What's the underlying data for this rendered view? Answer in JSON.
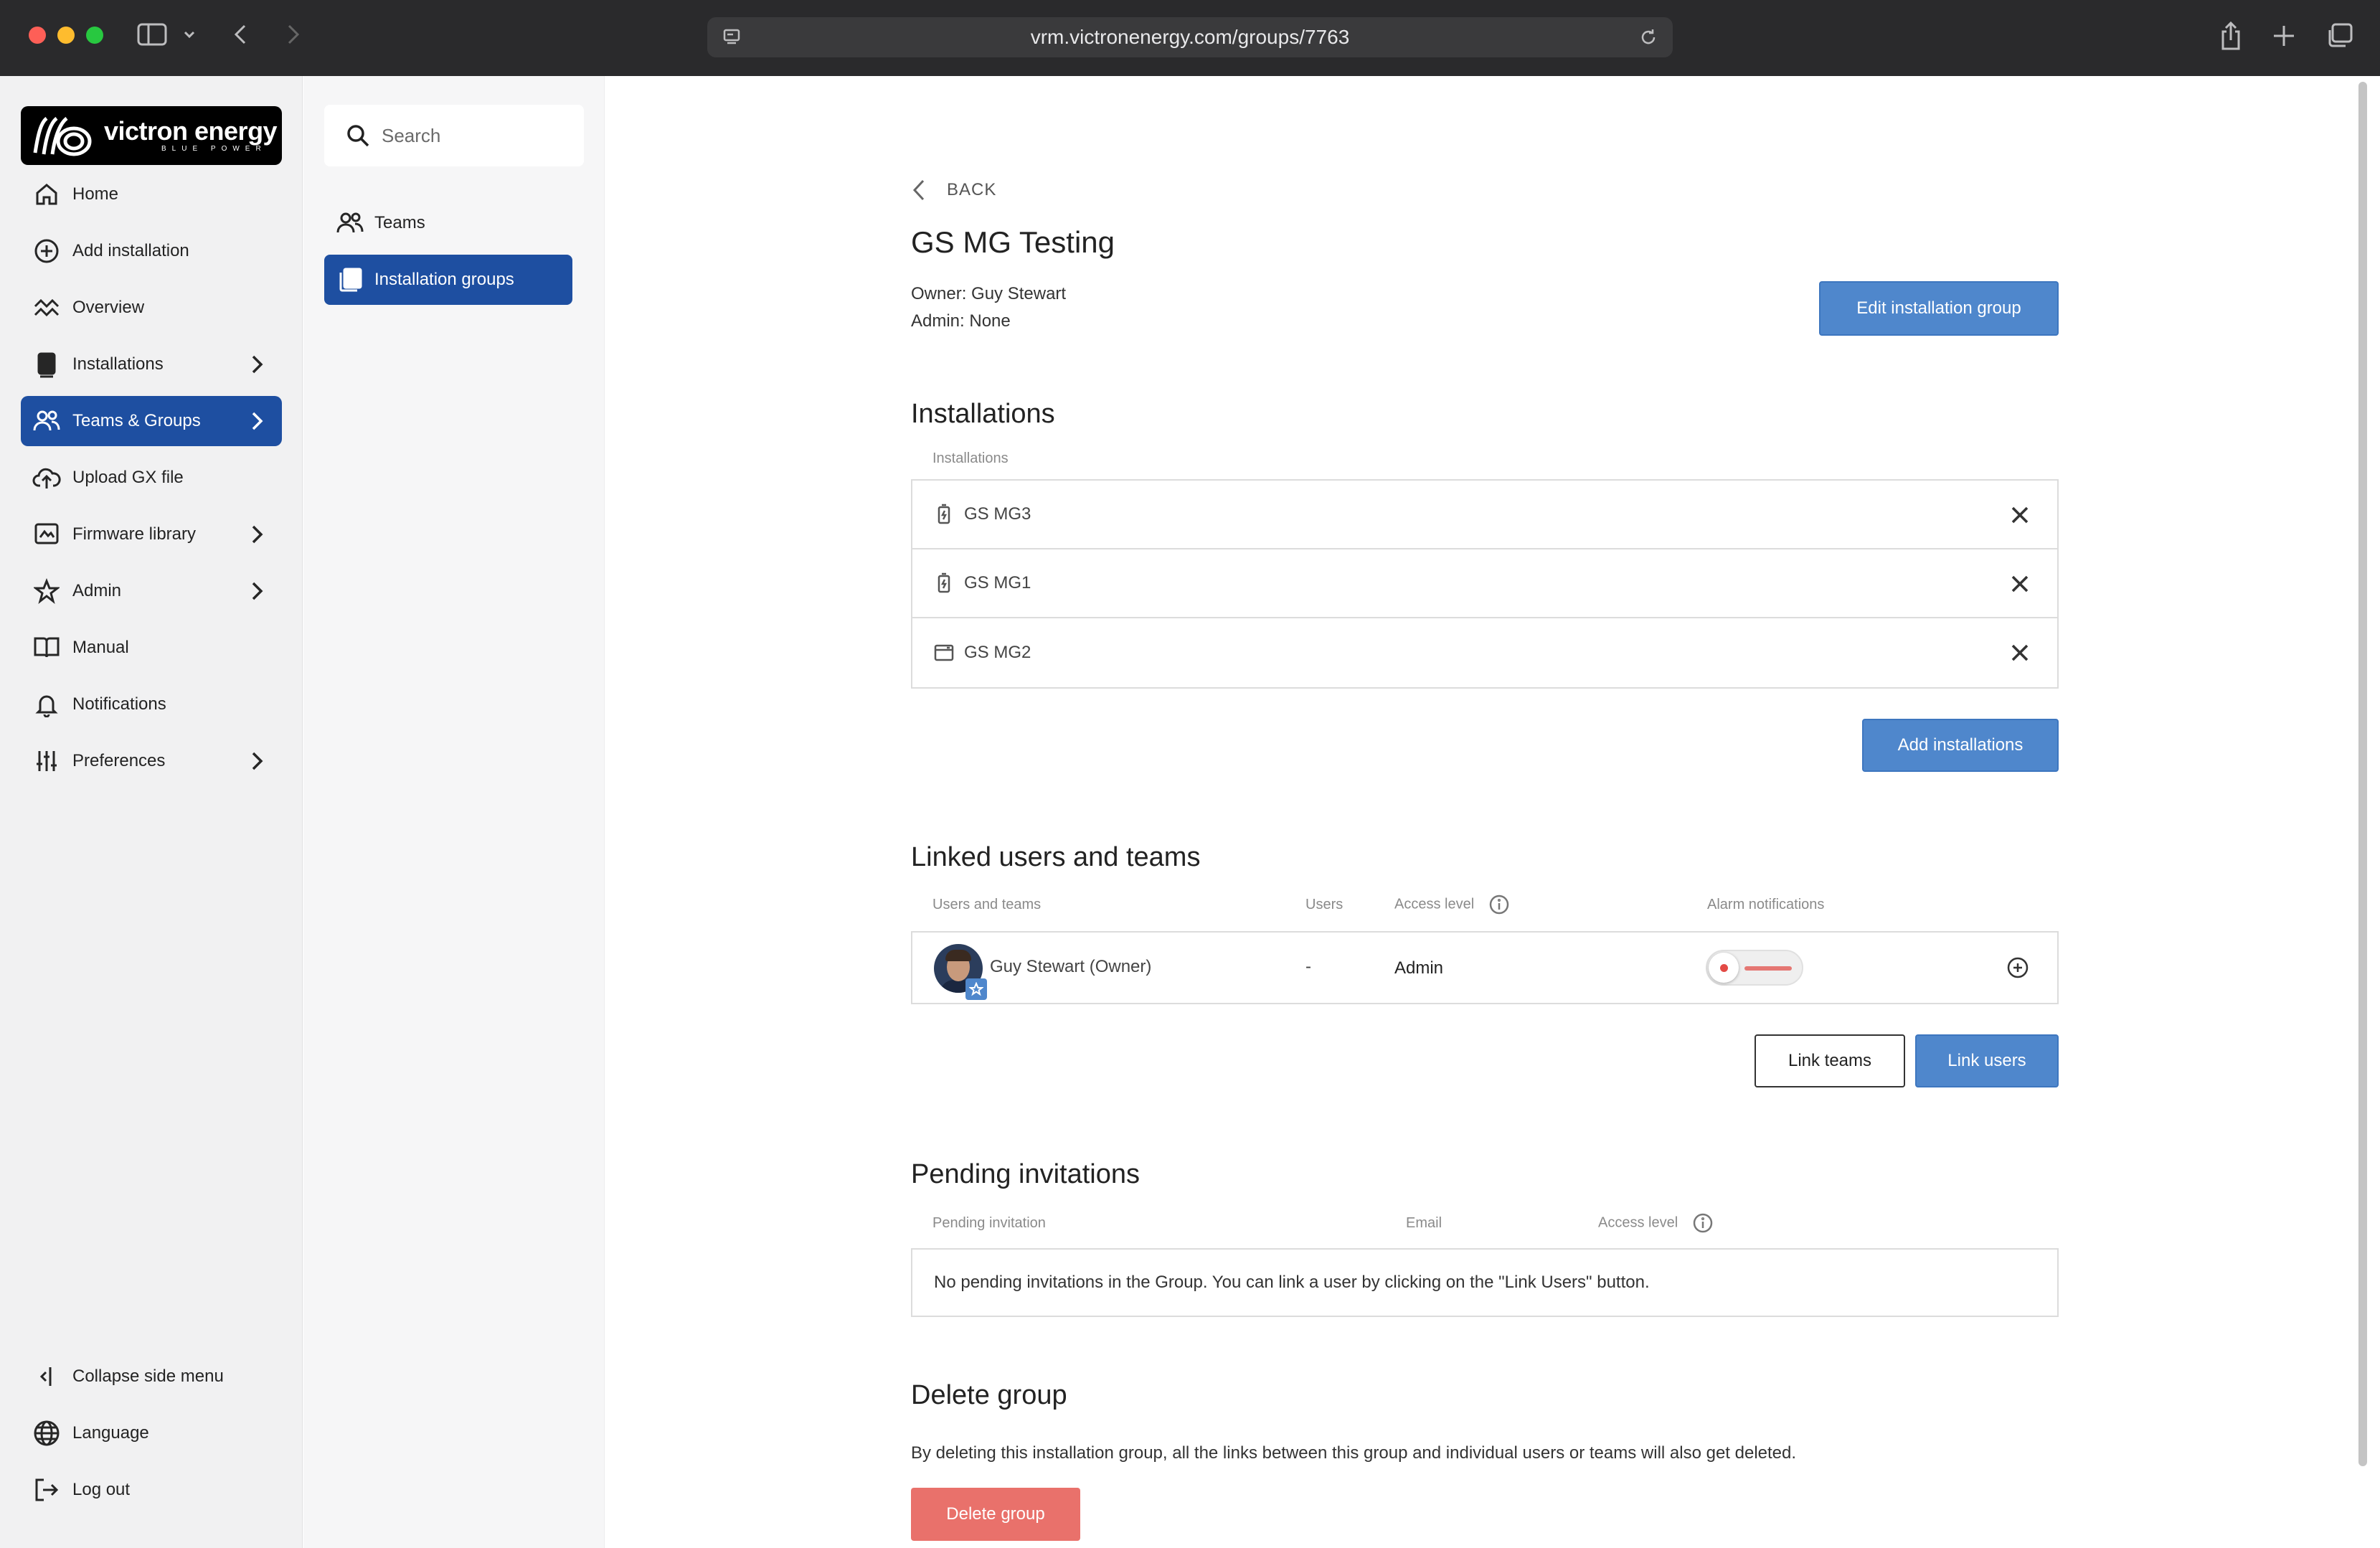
{
  "browser": {
    "url": "vrm.victronenergy.com/groups/7763"
  },
  "brand": {
    "name": "victron energy",
    "tagline": "BLUE POWER",
    "accent": "#1e4fa1"
  },
  "sidebar": {
    "items": [
      {
        "label": "Home",
        "icon": "home-icon"
      },
      {
        "label": "Add installation",
        "icon": "add-circle-icon"
      },
      {
        "label": "Overview",
        "icon": "overview-icon"
      },
      {
        "label": "Installations",
        "icon": "installation-icon"
      },
      {
        "label": "Teams & Groups",
        "icon": "users-icon",
        "active": true
      },
      {
        "label": "Upload GX file",
        "icon": "cloud-upload-icon"
      },
      {
        "label": "Firmware library",
        "icon": "firmware-icon"
      },
      {
        "label": "Admin",
        "icon": "star-icon"
      },
      {
        "label": "Manual",
        "icon": "book-icon"
      },
      {
        "label": "Notifications",
        "icon": "bell-icon"
      },
      {
        "label": "Preferences",
        "icon": "sliders-icon"
      }
    ],
    "footer": [
      {
        "label": "Collapse side menu",
        "icon": "collapse-icon"
      },
      {
        "label": "Language",
        "icon": "globe-icon"
      },
      {
        "label": "Log out",
        "icon": "logout-icon"
      }
    ]
  },
  "subnav": {
    "search_placeholder": "Search",
    "items": [
      {
        "label": "Teams",
        "icon": "users-icon"
      },
      {
        "label": "Installation groups",
        "icon": "stack-icon",
        "active": true
      }
    ]
  },
  "group": {
    "back_label": "BACK",
    "title": "GS MG Testing",
    "owner": "Owner: Guy Stewart",
    "admin": "Admin: None",
    "edit_button": "Edit installation group"
  },
  "installations": {
    "title": "Installations",
    "column": "Installations",
    "rows": [
      {
        "name": "GS MG3",
        "icon": "battery-icon"
      },
      {
        "name": "GS MG1",
        "icon": "battery-icon"
      },
      {
        "name": "GS MG2",
        "icon": "inverter-icon"
      }
    ],
    "add_button": "Add installations"
  },
  "linked": {
    "title": "Linked users and teams",
    "columns": {
      "users_and_teams": "Users and teams",
      "users": "Users",
      "access_level": "Access level",
      "alarm_notifications": "Alarm notifications"
    },
    "rows": [
      {
        "name": "Guy Stewart (Owner)",
        "users": "-",
        "access": "Admin",
        "alarm_notifications_on": false
      }
    ],
    "link_teams_button": "Link teams",
    "link_users_button": "Link users"
  },
  "pending": {
    "title": "Pending invitations",
    "columns": {
      "invitation": "Pending invitation",
      "email": "Email",
      "access_level": "Access level"
    },
    "empty_message": "No pending invitations in the Group. You can link a user by clicking on the \"Link Users\" button."
  },
  "delete": {
    "title": "Delete group",
    "description": "By deleting this installation group, all the links between this group and individual users or teams will also get deleted.",
    "button": "Delete group"
  }
}
